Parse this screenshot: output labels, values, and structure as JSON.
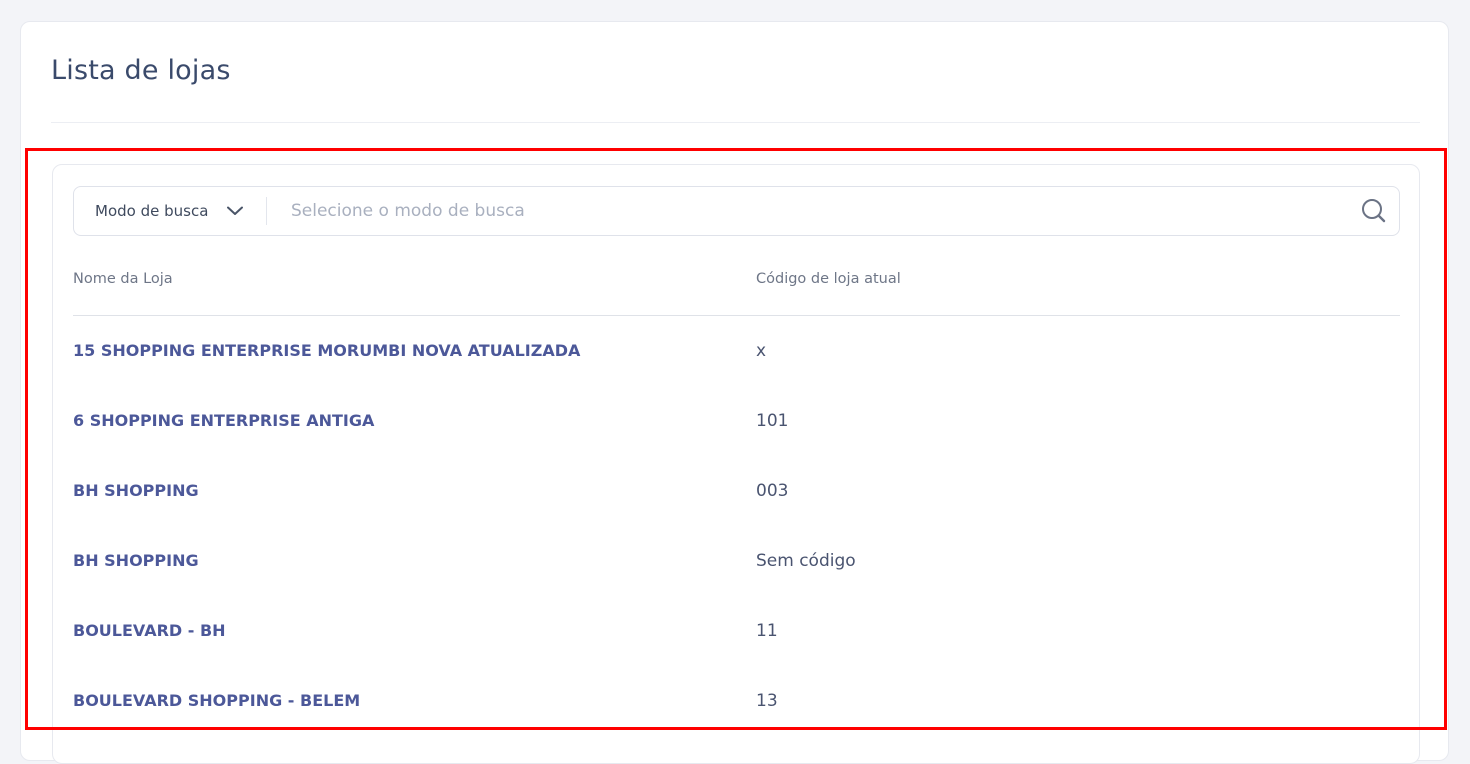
{
  "page": {
    "title": "Lista de lojas"
  },
  "search": {
    "mode_label": "Modo de busca",
    "placeholder": "Selecione o modo de busca",
    "value": ""
  },
  "table": {
    "headers": {
      "name": "Nome da Loja",
      "code": "Código de loja atual"
    },
    "rows": [
      {
        "name": "15 SHOPPING ENTERPRISE MORUMBI NOVA ATUALIZADA",
        "code": "x"
      },
      {
        "name": "6 SHOPPING ENTERPRISE ANTIGA",
        "code": "101"
      },
      {
        "name": "BH SHOPPING",
        "code": "003"
      },
      {
        "name": "BH SHOPPING",
        "code": "Sem código"
      },
      {
        "name": "BOULEVARD - BH",
        "code": "11"
      },
      {
        "name": "BOULEVARD SHOPPING - BELEM",
        "code": "13"
      }
    ]
  },
  "icons": {
    "mode_chevron": "chevron-down-icon",
    "search": "search-icon"
  },
  "colors": {
    "accent_text": "#4c5899",
    "highlight_frame": "#ff0000"
  }
}
